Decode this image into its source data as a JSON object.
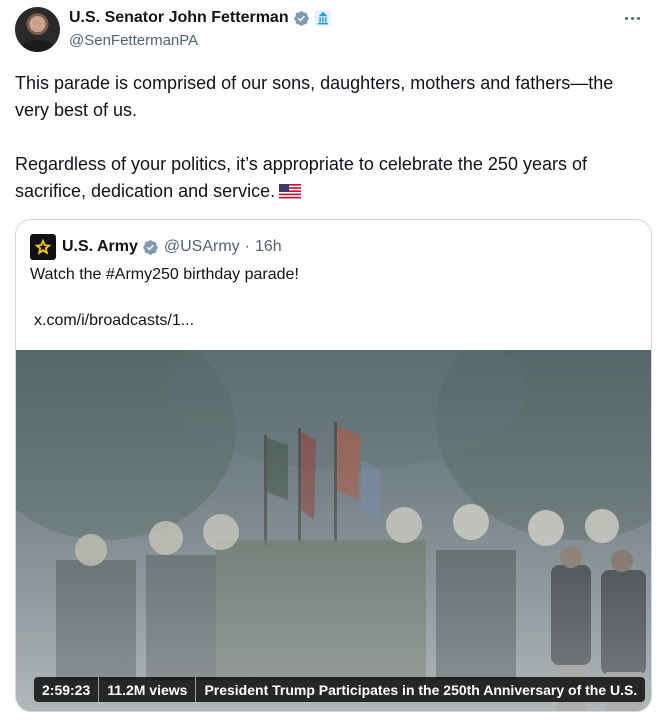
{
  "author": {
    "name": "U.S. Senator John Fetterman",
    "handle": "@SenFettermanPA",
    "verified_color": "#829aab",
    "gov_badge_color": "#1d9bf0"
  },
  "tweet": {
    "text": "This parade is comprised of our sons, daughters, mothers and fathers—the very best of us.\n\nRegardless of your politics, it’s appropriate to celebrate the 250 years of sacrifice, dedication and service."
  },
  "quote": {
    "name": "U.S. Army",
    "handle": "@USArmy",
    "separator": "·",
    "time": "16h",
    "text": "Watch the #Army250 birthday parade!",
    "link": "x.com/i/broadcasts/1...",
    "media": {
      "duration": "2:59:23",
      "views": "11.2M views",
      "title": "President Trump Participates in the 250th Anniversary of the U.S."
    }
  },
  "colors": {
    "text": "#0f1419",
    "secondary": "#536471",
    "border": "#cfd9de",
    "army_gold": "#f5c518"
  },
  "icons": [
    "verified-badge-icon",
    "government-badge-icon",
    "more-options-icon",
    "us-flag-emoji",
    "army-star-icon"
  ]
}
